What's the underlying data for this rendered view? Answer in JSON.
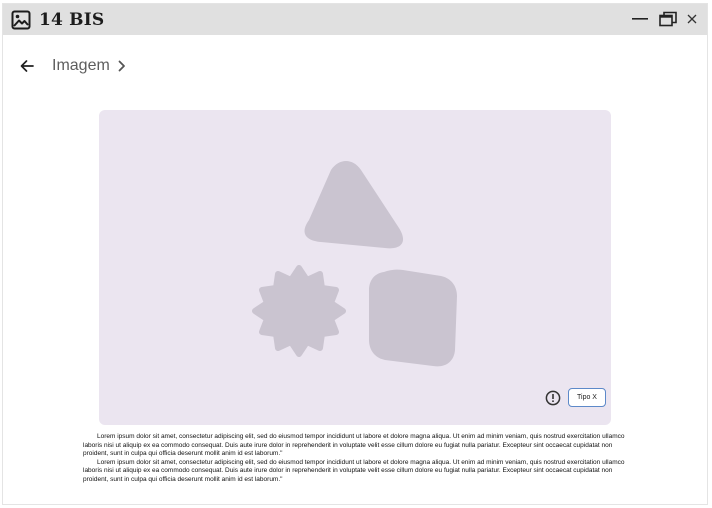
{
  "window": {
    "title": "14 BIS",
    "icons": {
      "app": "image-icon",
      "minimize": "minimize-icon",
      "maximize": "restore-icon",
      "close": "close-icon"
    }
  },
  "breadcrumb": {
    "label": "Imagem",
    "back_icon": "arrow-left-icon",
    "chevron_icon": "chevron-right-icon"
  },
  "image_card": {
    "placeholder_color": "#ebe5f0",
    "shape_color": "#cac4d0",
    "info_icon": "alert-circle-icon",
    "chip_label": "Tipo X",
    "chip_border": "#5d89c9"
  },
  "caption": {
    "paragraphs": [
      "Lorem ipsum dolor sit amet, consectetur adipiscing elit, sed do eiusmod tempor incididunt ut labore et dolore magna aliqua. Ut enim ad minim veniam, quis nostrud exercitation ullamco laboris nisi ut aliquip ex ea commodo consequat. Duis aute irure dolor in reprehenderit in voluptate velit esse cillum dolore eu fugiat nulla pariatur. Excepteur sint occaecat cupidatat non proident, sunt in culpa qui officia deserunt mollit anim id est laborum.\"",
      "Lorem ipsum dolor sit amet, consectetur adipiscing elit, sed do eiusmod tempor incididunt ut labore et dolore magna aliqua. Ut enim ad minim veniam, quis nostrud exercitation ullamco laboris nisi ut aliquip ex ea commodo consequat. Duis aute irure dolor in reprehenderit in voluptate velit esse cillum dolore eu fugiat nulla pariatur. Excepteur sint occaecat cupidatat non proident, sunt in culpa qui officia deserunt mollit anim id est laborum.\""
    ]
  }
}
